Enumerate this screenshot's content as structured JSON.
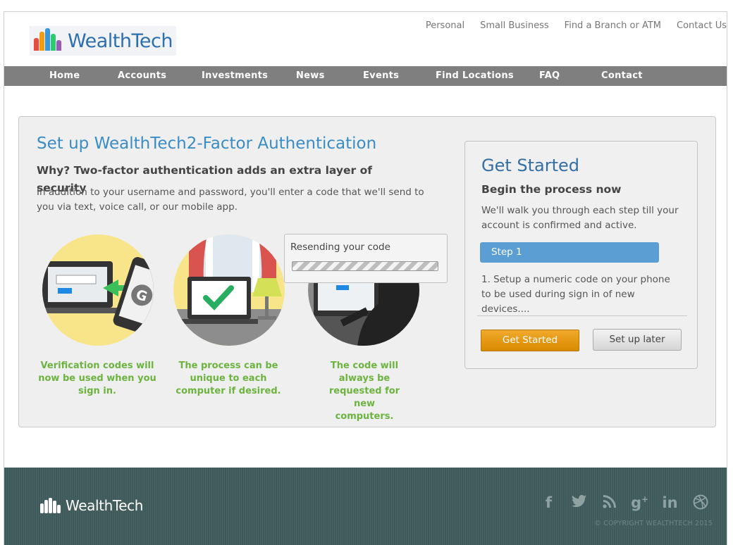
{
  "brand": {
    "name": "WealthTech"
  },
  "top_links": [
    "Personal",
    "Small Business",
    "Find a Branch or ATM",
    "Contact Us"
  ],
  "nav": [
    "Home",
    "Accounts",
    "Investments",
    "News",
    "Events",
    "Find Locations",
    "FAQ",
    "Contact"
  ],
  "main": {
    "title": "Set up WealthTech2-Factor Authentication",
    "why": "Why? Two-factor authentication adds an extra layer of security",
    "description": "In addition to your username and password, you'll enter a code that we'll send to you via text, voice call, or our mobile app.",
    "captions": [
      "Verification codes will now be used when you sign in.",
      "The process can be unique to each computer if desired.",
      "The code will always be requested for new computers."
    ],
    "toast": {
      "text": "Resending your code"
    }
  },
  "card": {
    "title": "Get Started",
    "subtitle": "Begin the process now",
    "description": "We'll walk you through each step till your account is confirmed and active.",
    "step_label": "Step 1",
    "step_text": "1. Setup a numeric code on your phone to be used during sign in of new devices....",
    "primary_button": "Get Started",
    "secondary_button": "Set up later"
  },
  "footer": {
    "brand": "WealthTech",
    "socials": [
      "facebook-icon",
      "twitter-icon",
      "rss-icon",
      "google-plus-icon",
      "linkedin-icon",
      "dribbble-icon"
    ],
    "copyright": "© COPYRIGHT WEALTHTECH 2015"
  },
  "colors": {
    "accent": "#3a8cc5",
    "nav": "#7f7f7f",
    "caption_green": "#6cb33f",
    "button_orange": "#e39a17",
    "footer": "#3f5a5a"
  }
}
